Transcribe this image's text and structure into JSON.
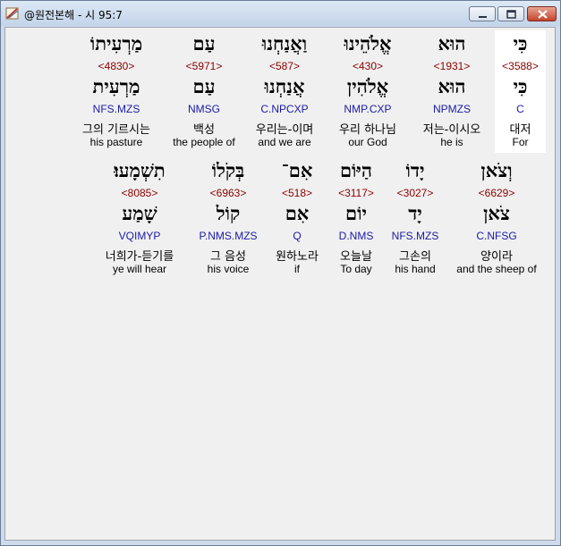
{
  "window": {
    "title": "@원전본해 - 시 95:7",
    "icon": "bible-app-icon",
    "controls": {
      "minimize": "minimize-icon",
      "maximize": "maximize-icon",
      "close": "close-icon"
    }
  },
  "verse": {
    "rows": [
      {
        "words": [
          {
            "heb": "כִּי",
            "strong": "<3588>",
            "lemma": "כִּי",
            "morph": "C",
            "kor": "대저",
            "eng": "For",
            "highlighted": true
          },
          {
            "heb": "הוּא",
            "strong": "<1931>",
            "lemma": "הוּא",
            "morph": "NPMZS",
            "kor": "저는-이시오",
            "eng": "he is",
            "highlighted": false
          },
          {
            "heb": "אֱלֹהֵינוּ",
            "strong": "<430>",
            "lemma": "אֱלֹהִין",
            "morph": "NMP.CXP",
            "kor": "우리 하나님",
            "eng": "our God",
            "highlighted": false
          },
          {
            "heb": "וַאֲנַחְנוּ",
            "strong": "<587>",
            "lemma": "אֲנַחְנוּ",
            "morph": "C.NPCXP",
            "kor": "우리는-이며",
            "eng": "and we are",
            "highlighted": false
          },
          {
            "heb": "עַם",
            "strong": "<5971>",
            "lemma": "עַם",
            "morph": "NMSG",
            "kor": "백성",
            "eng": "the people of",
            "highlighted": false
          },
          {
            "heb": "מַרְעִיתוֹ",
            "strong": "<4830>",
            "lemma": "מַרְעִית",
            "morph": "NFS.MZS",
            "kor": "그의 기르시는",
            "eng": "his pasture",
            "highlighted": false
          }
        ]
      },
      {
        "words": [
          {
            "heb": "וְצֹאן",
            "strong": "<6629>",
            "lemma": "צֹאן",
            "morph": "C.NFSG",
            "kor": "양이라",
            "eng": "and the sheep of",
            "highlighted": false
          },
          {
            "heb": "יָדוֹ",
            "strong": "<3027>",
            "lemma": "יָד",
            "morph": "NFS.MZS",
            "kor": "그손의",
            "eng": "his hand",
            "highlighted": false
          },
          {
            "heb": "הַיּוֹם",
            "strong": "<3117>",
            "lemma": "יוֹם",
            "morph": "D.NMS",
            "kor": "오늘날",
            "eng": "To day",
            "highlighted": false
          },
          {
            "heb": "אִם־",
            "strong": "<518>",
            "lemma": "אִם",
            "morph": "Q",
            "kor": "원하노라",
            "eng": "if",
            "highlighted": false
          },
          {
            "heb": "בְּקֹלוֹ",
            "strong": "<6963>",
            "lemma": "קוֹל",
            "morph": "P.NMS.MZS",
            "kor": "그 음성",
            "eng": "his voice",
            "highlighted": false
          },
          {
            "heb": "תִשְׁמָעוּ׃",
            "strong": "<8085>",
            "lemma": "שָׁמַע",
            "morph": "VQIMYP",
            "kor": "너희가-듣기를",
            "eng": "ye will hear",
            "highlighted": false
          }
        ]
      }
    ]
  }
}
